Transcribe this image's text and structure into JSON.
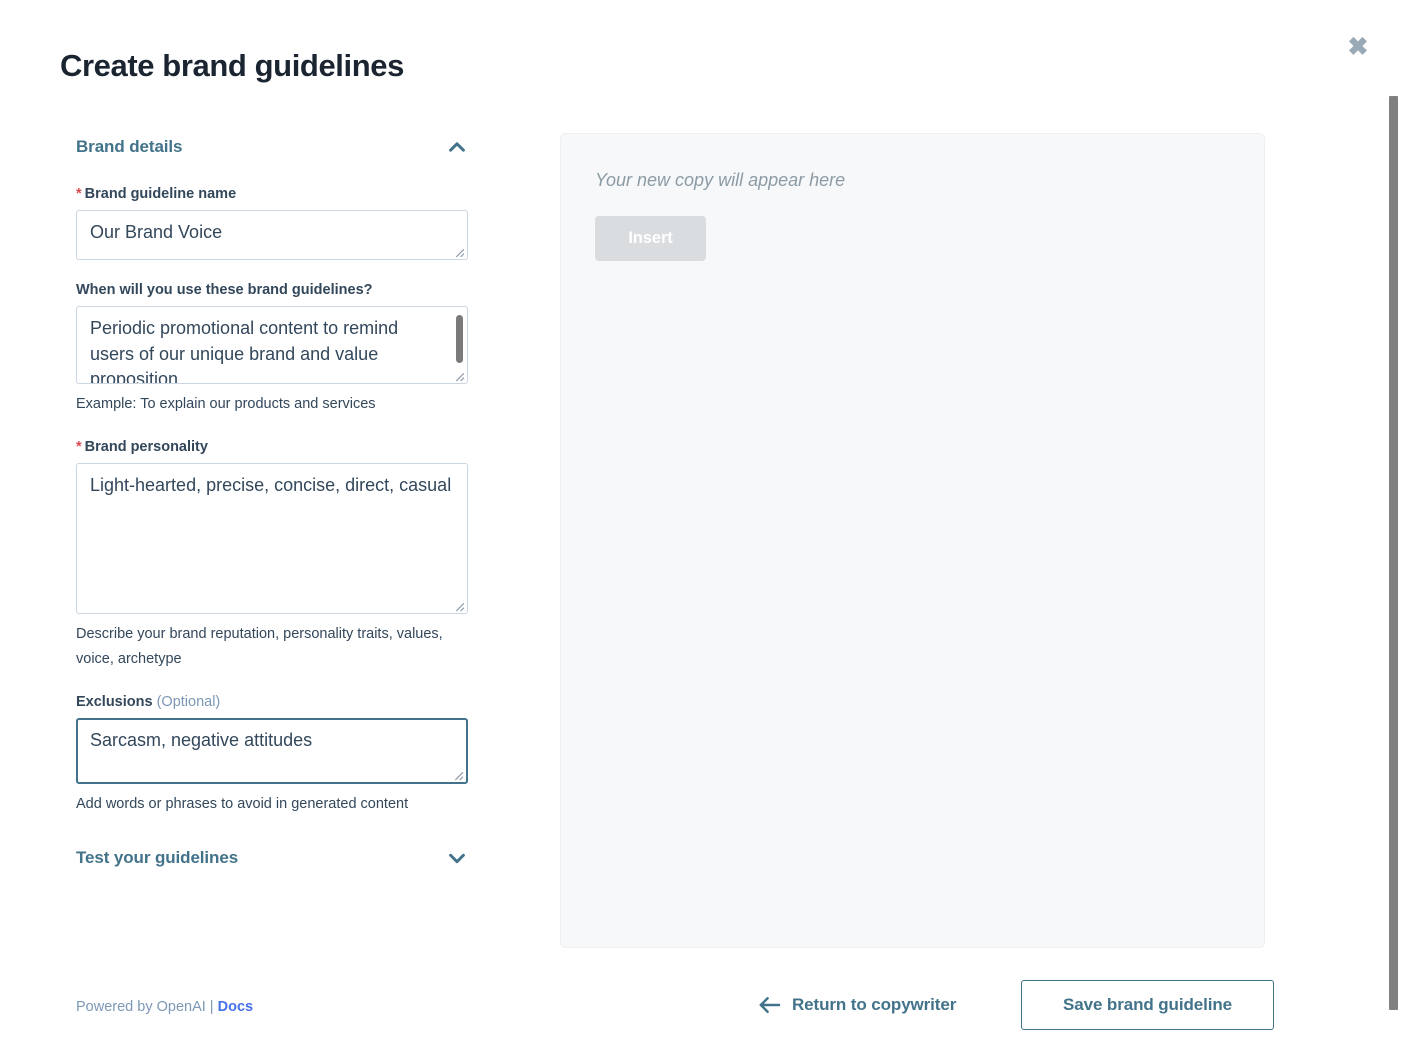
{
  "header": {
    "title": "Create brand guidelines",
    "close_icon": "close-icon"
  },
  "colors": {
    "accent_teal": "#42738A",
    "title_navy": "#1B2531",
    "label_slate": "#33475B",
    "required_red": "#D94C53",
    "docs_blue": "#4671E8",
    "panel_bg": "#F7F8F9",
    "input_border": "#CBD6E2",
    "disabled_button": "#D9DDE0"
  },
  "sections": {
    "brand_details": {
      "title": "Brand details",
      "chevron": "chevron-up-icon",
      "expanded": true
    },
    "test_guidelines": {
      "title": "Test your guidelines",
      "chevron": "chevron-down-icon",
      "expanded": false
    }
  },
  "fields": {
    "name": {
      "label": "Brand guideline name",
      "required": true,
      "value": "Our Brand Voice",
      "placeholder": "",
      "help": ""
    },
    "when": {
      "label": "When will you use these brand guidelines?",
      "required": false,
      "value": "Periodic promotional content to remind users of our unique brand and value proposition",
      "placeholder": "",
      "help": "Example: To explain our products and services"
    },
    "personality": {
      "label": "Brand personality",
      "required": true,
      "value": "Light-hearted, precise, concise, direct, casual",
      "placeholder": "",
      "help": "Describe your brand reputation, personality traits, values, voice, archetype"
    },
    "exclusions": {
      "label": "Exclusions",
      "optional_tag": "(Optional)",
      "required": false,
      "focused": true,
      "value": "Sarcasm, negative attitudes",
      "placeholder": "",
      "help": "Add words or phrases to avoid in generated content"
    }
  },
  "footer": {
    "powered_by": "Powered by OpenAI |",
    "docs_label": "Docs",
    "return_label": "Return to copywriter",
    "return_icon": "arrow-left-icon",
    "save_label": "Save brand guideline"
  },
  "preview": {
    "placeholder": "Your new copy will appear here",
    "insert_label": "Insert",
    "insert_disabled": true
  },
  "scrollbar": {
    "orientation": "vertical",
    "thumb_top_pct": 9,
    "thumb_height_pct": 86
  }
}
